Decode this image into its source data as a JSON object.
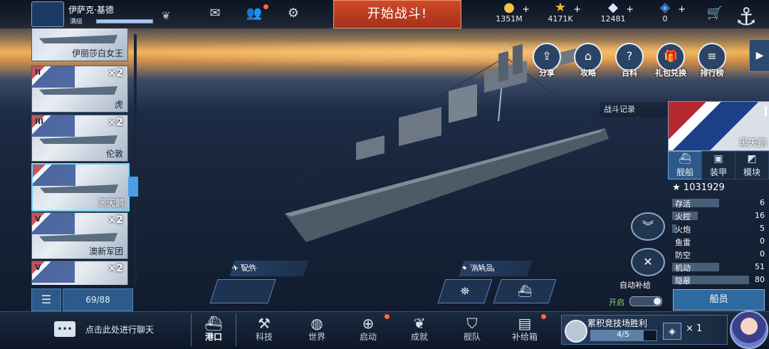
{
  "player": {
    "name": "伊萨克·基德",
    "level_label": "满级",
    "exp_fraction": 1.0
  },
  "top": {
    "start_battle": "开始战斗!"
  },
  "resources": [
    {
      "icon": "gold-coin-icon",
      "value": "1351M"
    },
    {
      "icon": "star-icon",
      "value": "4171K"
    },
    {
      "icon": "diamond-icon",
      "value": "12481"
    },
    {
      "icon": "crystal-icon",
      "value": "0"
    }
  ],
  "ship_list": [
    {
      "tier": "",
      "count": "",
      "name": "伊丽莎白女王"
    },
    {
      "tier": "II",
      "count": "×2",
      "name": "虎"
    },
    {
      "tier": "III",
      "count": "×2",
      "name": "伦敦"
    },
    {
      "tier": "",
      "count": "",
      "name": "黑天鹅",
      "selected": true
    },
    {
      "tier": "V",
      "count": "×2",
      "name": "澳新军团"
    },
    {
      "tier": "V",
      "count": "×2",
      "name": ""
    }
  ],
  "list_count": "69/88",
  "right_icons": [
    {
      "label": "分享",
      "icon": "share-icon"
    },
    {
      "label": "攻略",
      "icon": "guide-icon"
    },
    {
      "label": "百科",
      "icon": "encyclopedia-icon"
    },
    {
      "label": "礼包兑换",
      "icon": "gift-icon"
    },
    {
      "label": "排行榜",
      "icon": "ranking-icon"
    }
  ],
  "battle_record": "战斗记录",
  "selected_ship": {
    "name": "黑天鹅",
    "power": "1031929"
  },
  "right_tabs": [
    {
      "label": "舰船",
      "icon": "ship-icon"
    },
    {
      "label": "装甲",
      "icon": "armor-icon"
    },
    {
      "label": "模块",
      "icon": "module-icon"
    }
  ],
  "stats": [
    {
      "label": "存活",
      "value": "6",
      "fill": 0.55
    },
    {
      "label": "火控",
      "value": "16",
      "fill": 0.3
    },
    {
      "label": "火炮",
      "value": "5",
      "fill": 0.05
    },
    {
      "label": "鱼雷",
      "value": "0",
      "fill": 0
    },
    {
      "label": "防空",
      "value": "0",
      "fill": 0
    },
    {
      "label": "机动",
      "value": "51",
      "fill": 0.55
    },
    {
      "label": "隐蔽",
      "value": "80",
      "fill": 0.9
    }
  ],
  "crew_button": "船员",
  "auto_supply": {
    "label": "自动补给",
    "state": "开启"
  },
  "mid": {
    "parts": "配件",
    "consumables": "消耗品"
  },
  "chat_hint": "点击此处进行聊天",
  "nav": [
    {
      "label": "港口",
      "icon": "port-icon"
    },
    {
      "label": "科技",
      "icon": "tech-icon"
    },
    {
      "label": "世界",
      "icon": "world-icon"
    },
    {
      "label": "启动",
      "icon": "launch-icon"
    },
    {
      "label": "成就",
      "icon": "achievement-icon"
    },
    {
      "label": "舰队",
      "icon": "fleet-icon"
    },
    {
      "label": "补给箱",
      "icon": "supply-box-icon"
    }
  ],
  "arena": {
    "title": "累积竞技场胜利",
    "progress": "4/5",
    "fraction": 0.8,
    "reward_count": "× 1"
  }
}
